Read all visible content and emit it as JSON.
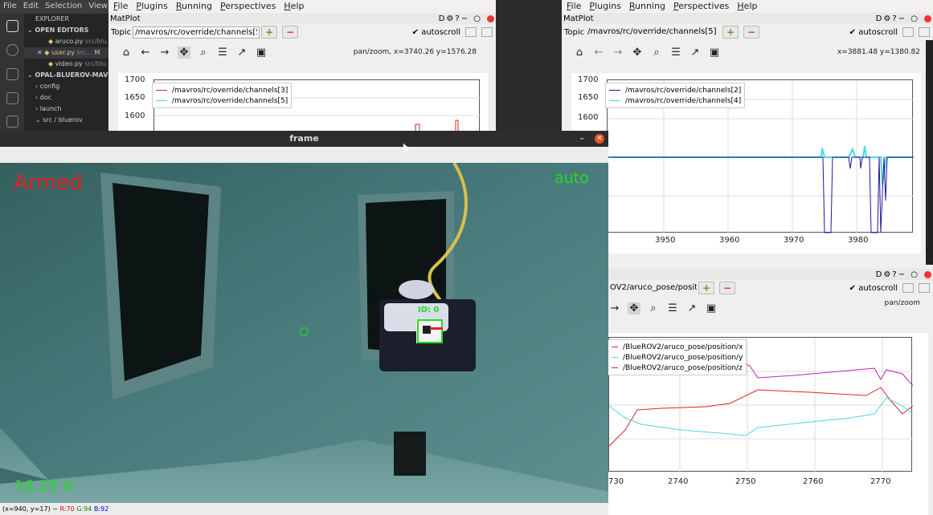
{
  "vscode": {
    "menu": [
      "File",
      "Edit",
      "Selection",
      "View",
      "G"
    ],
    "explorer_title": "EXPLORER",
    "open_editors_label": "OPEN EDITORS",
    "open_files": [
      {
        "name": "aruco.py",
        "path": "src/blu..."
      },
      {
        "name": "user.py",
        "path": "src...",
        "badge": "M"
      },
      {
        "name": "video.py",
        "path": "src/blu..."
      }
    ],
    "project_label": "OPAL-BLUEROV-MAVROS",
    "folders": [
      "config",
      "doc",
      "launch",
      "src / bluerov"
    ]
  },
  "plot_left": {
    "menu": [
      "File",
      "Plugins",
      "Running",
      "Perspectives",
      "Help"
    ],
    "title": "MatPlot",
    "topic_label": "Topic",
    "topic_value": "/mavros/rc/override/channels[5]",
    "autoscroll_label": "autoscroll",
    "status_text": "pan/zoom, x=3740.26      y=1576.28",
    "y_ticks": [
      "1700",
      "1650",
      "1600"
    ],
    "legend": [
      {
        "name": "/mavros/rc/override/channels[3]",
        "color": "#d62728"
      },
      {
        "name": "/mavros/rc/override/channels[5]",
        "color": "#4fd7e0"
      }
    ]
  },
  "plot_right": {
    "menu": [
      "File",
      "Plugins",
      "Running",
      "Perspectives",
      "Help"
    ],
    "title": "MatPlot",
    "topic_label": "Topic",
    "topic_value": "/mavros/rc/override/channels[5]",
    "autoscroll_label": "autoscroll",
    "status_text": "x=3881.48      y=1380.82",
    "y_ticks": [
      "1700",
      "1650",
      "1600"
    ],
    "x_ticks": [
      "3950",
      "3960",
      "3970",
      "3980"
    ],
    "legend": [
      {
        "name": "/mavros/rc/override/channels[2]",
        "color": "#1a1a9c"
      },
      {
        "name": "/mavros/rc/override/channels[4]",
        "color": "#4fd7e0"
      }
    ]
  },
  "plot_pose": {
    "topic_value": "OV2/aruco_pose/position",
    "autoscroll_label": "autoscroll",
    "status_text": "pan/zoom",
    "x_ticks": [
      "730",
      "2740",
      "2750",
      "2760",
      "2770"
    ],
    "legend": [
      {
        "name": "/BlueROV2/aruco_pose/position/x",
        "color": "#d62728"
      },
      {
        "name": "/BlueROV2/aruco_pose/position/y",
        "color": "#4fd7e0"
      },
      {
        "name": "/BlueROV2/aruco_pose/position/z",
        "color": "#c020c0"
      }
    ]
  },
  "frame": {
    "title": "frame",
    "armed_text": "Armed",
    "mode_text": "auto",
    "voltage_text": "16.25 V",
    "marker_id_text": "ID: 0",
    "status_prefix": "(x=940, y=17) ~",
    "status_r": "R:70",
    "status_g": "G:94",
    "status_b": "B:92"
  },
  "colors": {
    "overlay_red": "#e0231e",
    "overlay_green": "#22dd22"
  }
}
